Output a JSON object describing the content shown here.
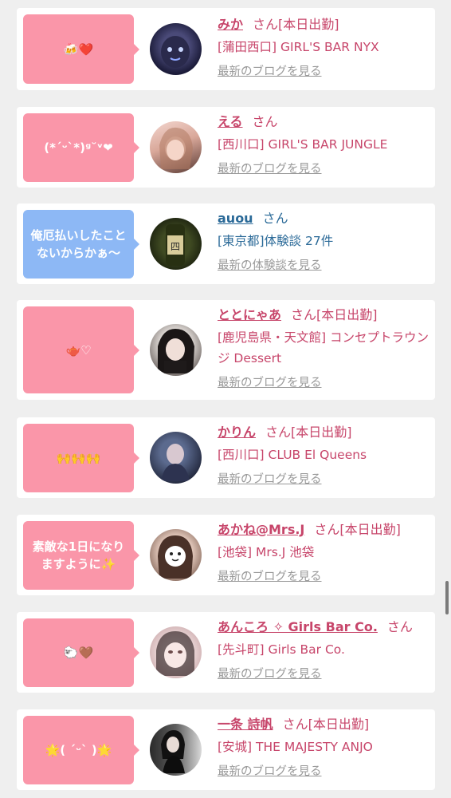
{
  "items": [
    {
      "bubble_text": "🍻❤️",
      "bubble_color": "#fa96a9",
      "avatar": "avatar-dark-mask",
      "name": "みか",
      "suffix": "さん[本日出勤]",
      "shop": "[蒲田西口] GIRL'S BAR NYX",
      "link": "最新のブログを見る"
    },
    {
      "bubble_text": "(*ˊᵕˋ*)ᵍ˘ᵛ❤",
      "bubble_color": "#fa96a9",
      "avatar": "avatar-girl-light",
      "name": "える",
      "suffix": "さん",
      "shop": "[西川口] GIRL'S BAR JUNGLE",
      "link": "最新のブログを見る"
    },
    {
      "bubble_text": "俺厄払いしたことないからかぁ〜",
      "bubble_color": "#8db8f5",
      "avatar": "avatar-sake-bottle",
      "name": "auou",
      "suffix": "さん",
      "shop": "[東京都]体験談 27件",
      "link": "最新の体験談を見る"
    },
    {
      "bubble_text": "🫖♡",
      "bubble_color": "#fa96a9",
      "avatar": "avatar-girl-black",
      "name": "ととにゃあ",
      "suffix": "さん[本日出勤]",
      "shop": "[鹿児島県・天文館] コンセプトラウンジ Dessert",
      "link": "最新のブログを見る"
    },
    {
      "bubble_text": "🙌🙌🙌",
      "bubble_color": "#fa96a9",
      "avatar": "avatar-girl-night",
      "name": "かりん",
      "suffix": "さん[本日出勤]",
      "shop": "[西川口] CLUB El Queens",
      "link": "最新のブログを見る"
    },
    {
      "bubble_text": "素敵な1日になりますように✨",
      "bubble_color": "#fa96a9",
      "avatar": "avatar-girl-sticker",
      "name": "あかね@Mrs.J",
      "suffix": "さん[本日出勤]",
      "shop": "[池袋] Mrs.J 池袋",
      "link": "最新のブログを見る"
    },
    {
      "bubble_text": "🐑🤎",
      "bubble_color": "#fa96a9",
      "avatar": "avatar-girl-blur",
      "name": "あんころ ✧ Girls Bar Co.",
      "suffix": "さん",
      "shop": "[先斗町] Girls Bar Co.",
      "link": "最新のブログを見る"
    },
    {
      "bubble_text": "🌟( ˊᵕˋ )🌟",
      "bubble_color": "#fa96a9",
      "avatar": "avatar-girl-dress",
      "name": "一条 詩帆",
      "suffix": "さん[本日出勤]",
      "shop": "[安城] THE MAJESTY ANJO",
      "link": "最新のブログを見る"
    }
  ]
}
